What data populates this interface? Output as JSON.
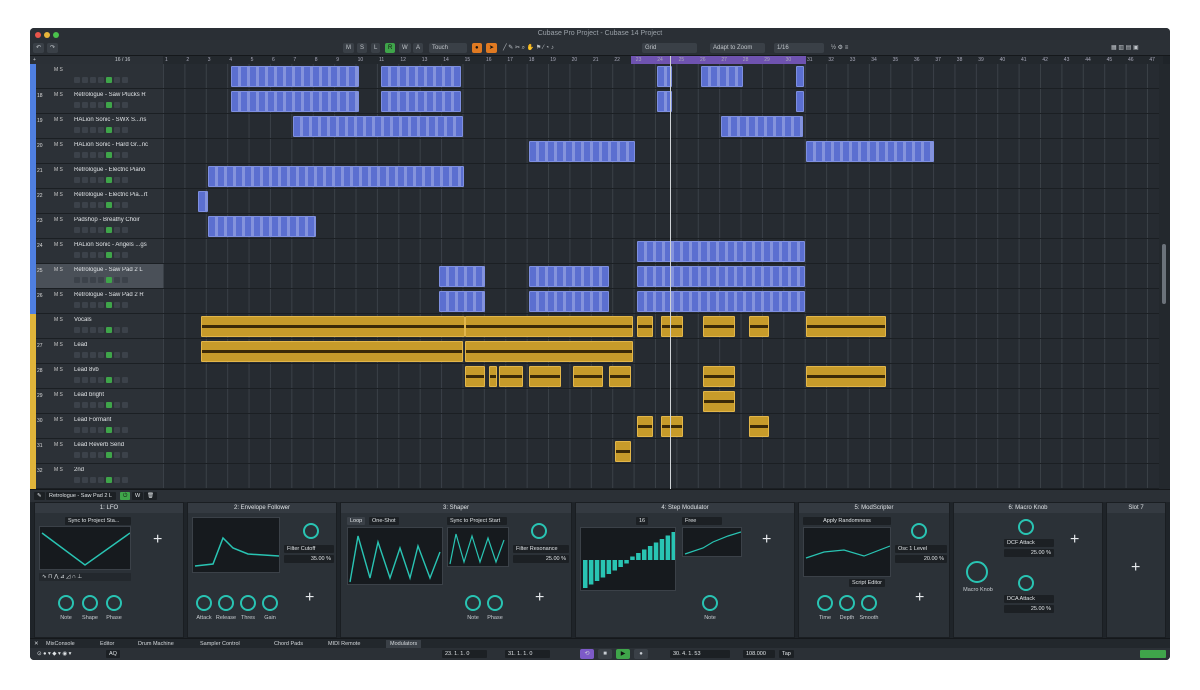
{
  "window": {
    "title": "Cubase Pro Project - Cubase 14 Project"
  },
  "toolbar": {
    "automation_mode": "Touch",
    "snap_type": "Grid",
    "zoom_mode": "Adapt to Zoom",
    "quantize": "1/16",
    "m": "M",
    "s": "S",
    "l": "L",
    "r": "R",
    "w": "W",
    "a": "A"
  },
  "ruler": {
    "bars": [
      "1",
      "2",
      "3",
      "4",
      "5",
      "6",
      "7",
      "8",
      "9",
      "10",
      "11",
      "12",
      "13",
      "14",
      "15",
      "16",
      "17",
      "18",
      "19",
      "20",
      "21",
      "22",
      "23",
      "24",
      "25",
      "26",
      "27",
      "28",
      "29",
      "30",
      "31",
      "32",
      "33",
      "34",
      "35",
      "36",
      "37",
      "38",
      "39",
      "40",
      "41",
      "42",
      "43",
      "44",
      "45",
      "46",
      "47"
    ]
  },
  "tracklist": {
    "header_count": "16 / 16"
  },
  "tracks": [
    {
      "num": "",
      "name": "",
      "color": "#4f7fe0",
      "sel": false
    },
    {
      "num": "18",
      "name": "Retrologue - Saw Plucks R",
      "color": "#4f7fe0",
      "sel": false
    },
    {
      "num": "19",
      "name": "HALion Sonic - SWX S...ns",
      "color": "#4f7fe0",
      "sel": false
    },
    {
      "num": "20",
      "name": "HALion Sonic - Hard Gr...nc",
      "color": "#4f7fe0",
      "sel": false
    },
    {
      "num": "21",
      "name": "Retrologue - Electric Piano",
      "color": "#4f7fe0",
      "sel": false
    },
    {
      "num": "22",
      "name": "Retrologue - Electric Pia...rt",
      "color": "#4f7fe0",
      "sel": false
    },
    {
      "num": "23",
      "name": "Padshop - Breathy Choir",
      "color": "#4f7fe0",
      "sel": false
    },
    {
      "num": "24",
      "name": "HALion Sonic - Angels ...gs",
      "color": "#4f7fe0",
      "sel": false
    },
    {
      "num": "25",
      "name": "Retrologue - Saw Pad 2 L",
      "color": "#4f7fe0",
      "sel": true
    },
    {
      "num": "26",
      "name": "Retrologue - Saw Pad 2 R",
      "color": "#4f7fe0",
      "sel": false
    },
    {
      "num": "",
      "name": "Vocals",
      "color": "#e0b43a",
      "sel": false
    },
    {
      "num": "27",
      "name": "Lead",
      "color": "#e0b43a",
      "sel": false
    },
    {
      "num": "28",
      "name": "Lead 8vb",
      "color": "#e0b43a",
      "sel": false
    },
    {
      "num": "29",
      "name": "Lead bright",
      "color": "#e0b43a",
      "sel": false
    },
    {
      "num": "30",
      "name": "Lead Formant",
      "color": "#e0b43a",
      "sel": false
    },
    {
      "num": "31",
      "name": "Lead Reverb Send",
      "color": "#e0b43a",
      "sel": false
    },
    {
      "num": "32",
      "name": "2nd",
      "color": "#e0b43a",
      "sel": false
    }
  ],
  "track_ms": "M  S",
  "lower": {
    "track_name": "Retrologue - Saw Pad 2 L"
  },
  "modulators": [
    {
      "title": "1: LFO",
      "sync": "Sync to Project Sta...",
      "knobs": [
        "Note",
        "Shape",
        "Phase"
      ]
    },
    {
      "title": "2: Envelope Follower",
      "target": "Filter Cutoff",
      "target_value": "35.00 %",
      "knobs": [
        "Attack",
        "Release",
        "Thres",
        "Gain"
      ]
    },
    {
      "title": "3: Shaper",
      "tab1": "Loop",
      "tab2": "One-Shot",
      "sync": "Sync to Project Start",
      "target": "Filter Resonance",
      "target_value": "25.00 %",
      "knobs": [
        "Note",
        "Phase"
      ]
    },
    {
      "title": "4: Step Modulator",
      "steps": "16",
      "mode": "Free",
      "knobs": [
        "Note"
      ]
    },
    {
      "title": "5: ModScripter",
      "script": "Apply Randomness",
      "target": "Osc 1 Level",
      "target_value": "20.00 %",
      "edit": "Script Editor",
      "knobs": [
        "Time",
        "Depth",
        "Smooth"
      ]
    },
    {
      "title": "6: Macro Knob",
      "target1": "DCF Attack",
      "target1_value": "25.00 %",
      "target2": "DCA Attack",
      "target2_value": "25.00 %",
      "knob": "Macro Knob"
    },
    {
      "title": "Slot 7"
    }
  ],
  "tabs": [
    "MixConsole",
    "Editor",
    "Drum Machine",
    "Sampler Control",
    "Chord Pads",
    "MIDI Remote",
    "Modulators"
  ],
  "tabs_active": "Modulators",
  "status": {
    "left_locator": "23. 1. 1. 0",
    "right_locator": "31. 1. 1. 0",
    "position": "30. 4. 1. 53",
    "tempo": "108.000",
    "tap": "Tap",
    "aq": "AQ"
  }
}
